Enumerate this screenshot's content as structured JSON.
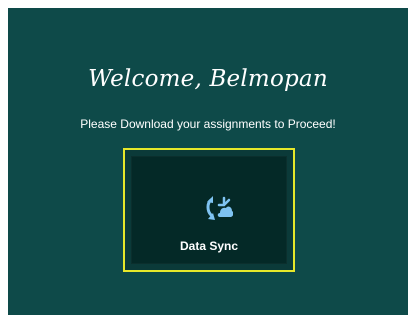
{
  "welcome": {
    "title": "Welcome, Belmopan",
    "subtitle": "Please Download your assignments to Proceed!"
  },
  "sync_tile": {
    "label": "Data Sync",
    "icon": "cloud-sync-icon"
  },
  "colors": {
    "background": "#0e4a49",
    "tile_background": "#042927",
    "tile_border": "#e6e82a",
    "icon": "#7fc3f2"
  }
}
